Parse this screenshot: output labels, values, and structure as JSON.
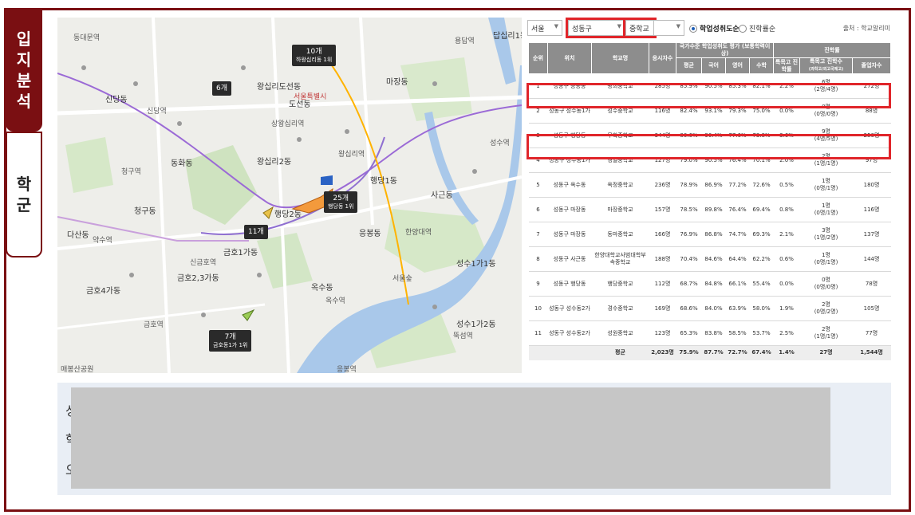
{
  "tabs": [
    {
      "label_chars": [
        "입",
        "지",
        "분",
        "석"
      ]
    },
    {
      "label_chars": [
        "학",
        "군"
      ]
    }
  ],
  "controls": {
    "region": "서울",
    "district": "성동구",
    "school_level": "중학교",
    "radio_on": "학업성취도순",
    "radio_off": "진학률순",
    "source": "출처 : 학교알리미"
  },
  "table": {
    "headers": {
      "rank": "순위",
      "location": "위치",
      "school": "학교명",
      "test_takers": "응시자수",
      "achievement_group": "국가수준 학업성취도 평가 (보통학력이상)",
      "avg": "평균",
      "korean": "국어",
      "english": "영어",
      "math": "수학",
      "progress_group": "진학률",
      "special_rate": "특목고 진학률",
      "special_count": "특목고 진학수",
      "special_count_sub": "(과학고/외고국제고)",
      "graduates": "졸업자수"
    },
    "rows": [
      {
        "rank": "1",
        "location": "성동구 응봉동",
        "school": "광희중학교",
        "test": "285명",
        "avg": "85.9%",
        "kor": "90.5%",
        "eng": "85.3%",
        "math": "82.1%",
        "rate": "2.2%",
        "count": "6명",
        "count_sub": "(2명/4명)",
        "grad": "272명"
      },
      {
        "rank": "2",
        "location": "성동구 성수동1가",
        "school": "성수중학교",
        "test": "116명",
        "avg": "82.4%",
        "kor": "93.1%",
        "eng": "79.3%",
        "math": "75.0%",
        "rate": "0.0%",
        "count": "0명",
        "count_sub": "(0명/0명)",
        "grad": "88명"
      },
      {
        "rank": "3",
        "location": "성동구 행당동",
        "school": "무학중학교",
        "test": "344명",
        "avg": "80.6%",
        "kor": "90.4%",
        "eng": "77.6%",
        "math": "73.8%",
        "rate": "3.6%",
        "count": "9명",
        "count_sub": "(4명/5명)",
        "grad": "250명"
      },
      {
        "rank": "4",
        "location": "성동구 성수동1가",
        "school": "경일중학교",
        "test": "127명",
        "avg": "79.0%",
        "kor": "90.5%",
        "eng": "76.4%",
        "math": "70.1%",
        "rate": "2.0%",
        "count": "2명",
        "count_sub": "(1명/1명)",
        "grad": "97명"
      },
      {
        "rank": "5",
        "location": "성동구 옥수동",
        "school": "옥정중학교",
        "test": "236명",
        "avg": "78.9%",
        "kor": "86.9%",
        "eng": "77.2%",
        "math": "72.6%",
        "rate": "0.5%",
        "count": "1명",
        "count_sub": "(0명/1명)",
        "grad": "180명"
      },
      {
        "rank": "6",
        "location": "성동구 마장동",
        "school": "마장중학교",
        "test": "157명",
        "avg": "78.5%",
        "kor": "89.8%",
        "eng": "76.4%",
        "math": "69.4%",
        "rate": "0.8%",
        "count": "1명",
        "count_sub": "(0명/1명)",
        "grad": "116명"
      },
      {
        "rank": "7",
        "location": "성동구 마장동",
        "school": "동마중학교",
        "test": "166명",
        "avg": "76.9%",
        "kor": "86.8%",
        "eng": "74.7%",
        "math": "69.3%",
        "rate": "2.1%",
        "count": "3명",
        "count_sub": "(1명/2명)",
        "grad": "137명"
      },
      {
        "rank": "8",
        "location": "성동구 사근동",
        "school": "한양대학교사범대학부속중학교",
        "test": "188명",
        "avg": "70.4%",
        "kor": "84.6%",
        "eng": "64.4%",
        "math": "62.2%",
        "rate": "0.6%",
        "count": "1명",
        "count_sub": "(0명/1명)",
        "grad": "144명"
      },
      {
        "rank": "9",
        "location": "성동구 행당동",
        "school": "행당중학교",
        "test": "112명",
        "avg": "68.7%",
        "kor": "84.8%",
        "eng": "66.1%",
        "math": "55.4%",
        "rate": "0.0%",
        "count": "0명",
        "count_sub": "(0명/0명)",
        "grad": "78명"
      },
      {
        "rank": "10",
        "location": "성동구 성수동2가",
        "school": "경수중학교",
        "test": "169명",
        "avg": "68.6%",
        "kor": "84.0%",
        "eng": "63.9%",
        "math": "58.0%",
        "rate": "1.9%",
        "count": "2명",
        "count_sub": "(0명/2명)",
        "grad": "105명"
      },
      {
        "rank": "11",
        "location": "성동구 성수동2가",
        "school": "성원중학교",
        "test": "123명",
        "avg": "65.3%",
        "kor": "83.8%",
        "eng": "58.5%",
        "math": "53.7%",
        "rate": "2.5%",
        "count": "2명",
        "count_sub": "(1명/1명)",
        "grad": "77명"
      }
    ],
    "average": {
      "label": "평균",
      "test": "2,023명",
      "avg": "75.9%",
      "kor": "87.7%",
      "eng": "72.7%",
      "math": "67.4%",
      "rate": "1.4%",
      "count": "27명",
      "grad": "1,544명"
    }
  },
  "map": {
    "badges": [
      {
        "count": "10개",
        "sub": "하왕십리동 1위"
      },
      {
        "count": "6개",
        "sub": ""
      },
      {
        "count": "25개",
        "sub": "행당동 1위"
      },
      {
        "count": "11개",
        "sub": ""
      },
      {
        "count": "7개",
        "sub": "금호동1가 1위"
      }
    ],
    "labels": [
      "왕십리도선동",
      "행당1동",
      "행당2동",
      "사근동",
      "금호1가동",
      "옥수동",
      "마장동",
      "왕십리2동",
      "응봉동",
      "성수1가2동",
      "성수1가1동",
      "도선동",
      "금호2,3가동",
      "금호4가동",
      "청구동",
      "다산동",
      "동화동",
      "답십리1동",
      "신당동",
      "상왕십리역",
      "왕십리역",
      "한양대역",
      "서울숲",
      "성수역",
      "뚝섬역",
      "행당역",
      "신금호역",
      "금호역",
      "옥수역",
      "응봉역",
      "신당역",
      "청구역",
      "동대문역",
      "약수역",
      "용답역"
    ],
    "footer_left": "매봉산공원",
    "footer_right": "응봉역"
  },
  "bottom": {
    "lines": [
      "성",
      "학",
      "오"
    ]
  }
}
